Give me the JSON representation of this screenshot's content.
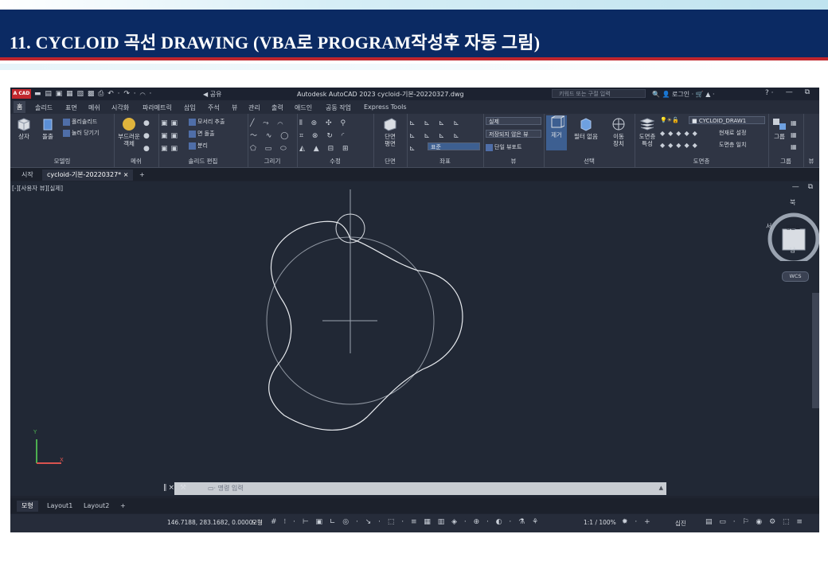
{
  "slide": {
    "title": "11.  CYCLOID 곡선 DRAWING (VBA로 PROGRAM작성후 자동 그림)"
  },
  "acad": {
    "app_button": "A CAD",
    "share_label": "공유",
    "window_title": "Autodesk AutoCAD 2023    cycloid-기본-20220327.dwg",
    "search_placeholder": "키워드 또는 구절 입력",
    "login_label": "로그인",
    "menu": [
      "홈",
      "솔리드",
      "표면",
      "메쉬",
      "시각화",
      "파라메트릭",
      "삽입",
      "주석",
      "뷰",
      "관리",
      "출력",
      "애드인",
      "공동 작업",
      "Express Tools"
    ],
    "ribbon": {
      "modeling": {
        "box": "상자",
        "extrude": "돌출",
        "polysolid": "폴리솔리드",
        "presspull": "눌러 당기기",
        "label": "모델링"
      },
      "mesh": {
        "smooth": "부드러운\n객체",
        "label": "메쉬"
      },
      "solid_edit": {
        "fillet": "모서리 추출",
        "extrude_face": "면 돌출",
        "separate": "분리",
        "label": "솔리드 편집"
      },
      "draw": {
        "label": "그리기"
      },
      "modify": {
        "label": "수정"
      },
      "section": {
        "plane": "단면\n평면",
        "label": "단면"
      },
      "coords": {
        "world": "표준",
        "label": "좌표"
      },
      "view": {
        "visual_style": "실제",
        "unsaved_view": "저장되지 않은 뷰",
        "single_viewport": "단일 뷰포트",
        "label": "뷰"
      },
      "selection": {
        "culling": "제거",
        "filter": "필터 없음",
        "gizmo": "이동\n장치",
        "label": "선택"
      },
      "layers": {
        "current": "CYCLOID_DRAW1",
        "make_current": "현재로 설정",
        "match": "도면층 일치",
        "properties": "도면층\n특성",
        "label": "도면층"
      },
      "groups": {
        "group": "그룹",
        "label": "그룹"
      },
      "view2": {
        "label": "뷰"
      }
    },
    "file_tabs": {
      "start": "시작",
      "doc": "cycloid-기본-20220327*"
    },
    "viewport_label": "[-][사용자 뷰][실제]",
    "viewcube": {
      "north": "북",
      "south": "남",
      "west": "서",
      "face": "평면도",
      "wcs": "WCS"
    },
    "command_placeholder": "명령 입력",
    "layout_tabs": [
      "모형",
      "Layout1",
      "Layout2"
    ],
    "status": {
      "coords": "146.7188, 283.1682, 0.0000",
      "model": "모형",
      "scale": "1:1 / 100%",
      "workspace": "십진"
    },
    "colors": {
      "accent": "#0b2a63",
      "stripe": "#c0262d",
      "background": "#212835"
    }
  }
}
